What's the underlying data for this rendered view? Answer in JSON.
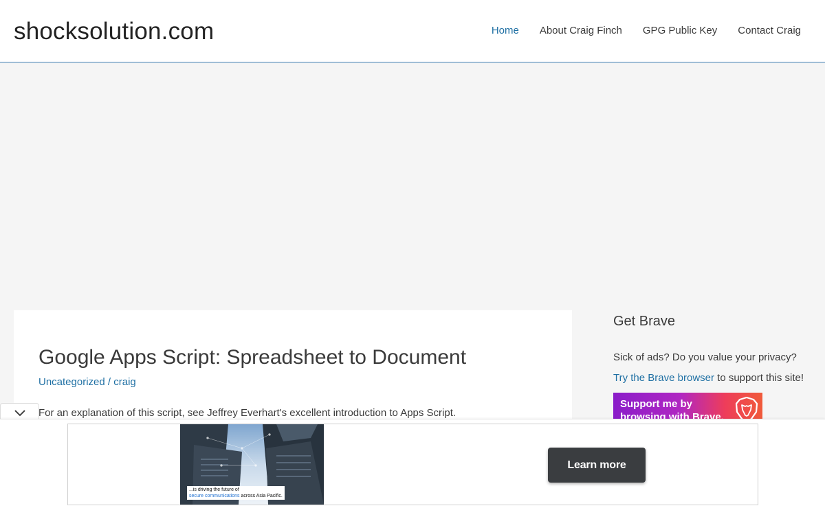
{
  "header": {
    "site_title": "shocksolution.com",
    "nav": [
      {
        "label": "Home",
        "active": true
      },
      {
        "label": "About Craig Finch",
        "active": false
      },
      {
        "label": "GPG Public Key",
        "active": false
      },
      {
        "label": "Contact Craig",
        "active": false
      }
    ]
  },
  "article": {
    "title": "Google Apps Script: Spreadsheet to Document",
    "category": "Uncategorized",
    "separator": "/",
    "author": "craig",
    "intro": "For an explanation of this script, see Jeffrey Everhart's excellent introduction to Apps Script."
  },
  "sidebar": {
    "widget_title": "Get Brave",
    "text_before": "Sick of ads? Do you value your privacy? ",
    "link_text": "Try the Brave browser",
    "text_after": " to support this site!",
    "banner_text": "Support me by browsing with Brave."
  },
  "bottom_ad": {
    "caption_before": "...is driving the future of",
    "caption_highlight": "secure communications",
    "caption_after": " across Asia Pacific.",
    "button_label": "Learn more"
  },
  "icons": {
    "collapse": "chevron-down-icon",
    "brave": "brave-lion-icon"
  },
  "colors": {
    "link": "#1e6fa3",
    "button_bg": "#3a3d40",
    "page_bg": "#f5f5f5"
  }
}
